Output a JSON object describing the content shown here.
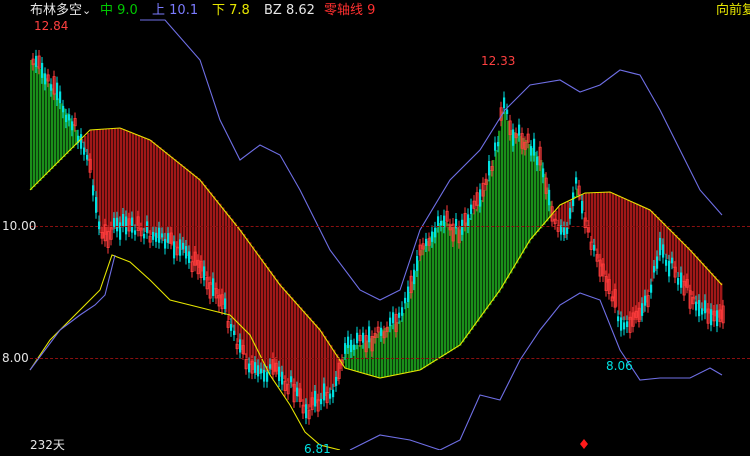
{
  "indicator": {
    "name": "布林多空",
    "dropdown_icon": "chevron-down-icon",
    "mid": {
      "label": "中",
      "value": "9.0",
      "color": "#00c800"
    },
    "upper": {
      "label": "上",
      "value": "10.1",
      "color": "#7b7bff"
    },
    "lower": {
      "label": "下",
      "value": "7.8",
      "color": "#e6e600"
    },
    "bz": {
      "label": "BZ",
      "value": "8.62",
      "color": "#e6e6e6"
    },
    "zero": {
      "label": "零轴线",
      "value": "9",
      "color": "#ff3030"
    }
  },
  "adjust_label": "向前复",
  "price_axis": {
    "line_high": "10.00",
    "line_low": "8.00"
  },
  "annotations": {
    "top_left_high": "12.84",
    "peak_high": "12.33",
    "trough_low": "6.81",
    "recent_low": "8.06"
  },
  "period_label": "232天",
  "colors": {
    "background": "#000000",
    "up": "#ff3c3c",
    "down": "#00e0e0",
    "bull_fill": "#1a8f1a",
    "bear_fill": "#a01818",
    "upper_band": "#6f6fe6",
    "lower_band": "#e6e600",
    "grid": "#8a1010",
    "marker": "#ff1a1a"
  }
}
